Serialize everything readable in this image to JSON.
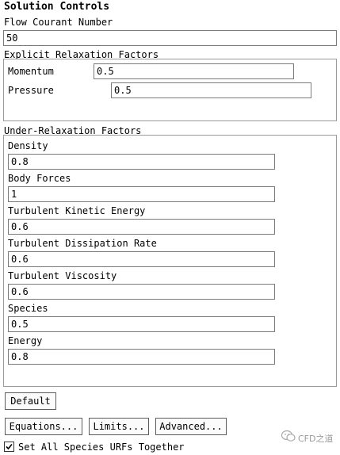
{
  "panel_title": "Solution Controls",
  "flow_courant": {
    "label": "Flow Courant Number",
    "value": "50"
  },
  "explicit": {
    "label": "Explicit Relaxation Factors",
    "momentum": {
      "label": "Momentum",
      "value": "0.5"
    },
    "pressure": {
      "label": "Pressure",
      "value": "0.5"
    }
  },
  "under_relaxation": {
    "label": "Under-Relaxation Factors",
    "fields": [
      {
        "label": "Density",
        "value": "0.8"
      },
      {
        "label": "Body Forces",
        "value": "1"
      },
      {
        "label": "Turbulent Kinetic Energy",
        "value": "0.6"
      },
      {
        "label": "Turbulent Dissipation Rate",
        "value": "0.6"
      },
      {
        "label": "Turbulent Viscosity",
        "value": "0.6"
      },
      {
        "label": "Species",
        "value": "0.5"
      },
      {
        "label": "Energy",
        "value": "0.8"
      }
    ]
  },
  "buttons": {
    "default": "Default",
    "equations": "Equations...",
    "limits": "Limits...",
    "advanced": "Advanced..."
  },
  "checkbox": {
    "label": "Set All Species URFs Together",
    "checked": true
  },
  "watermark": "CFD之道"
}
